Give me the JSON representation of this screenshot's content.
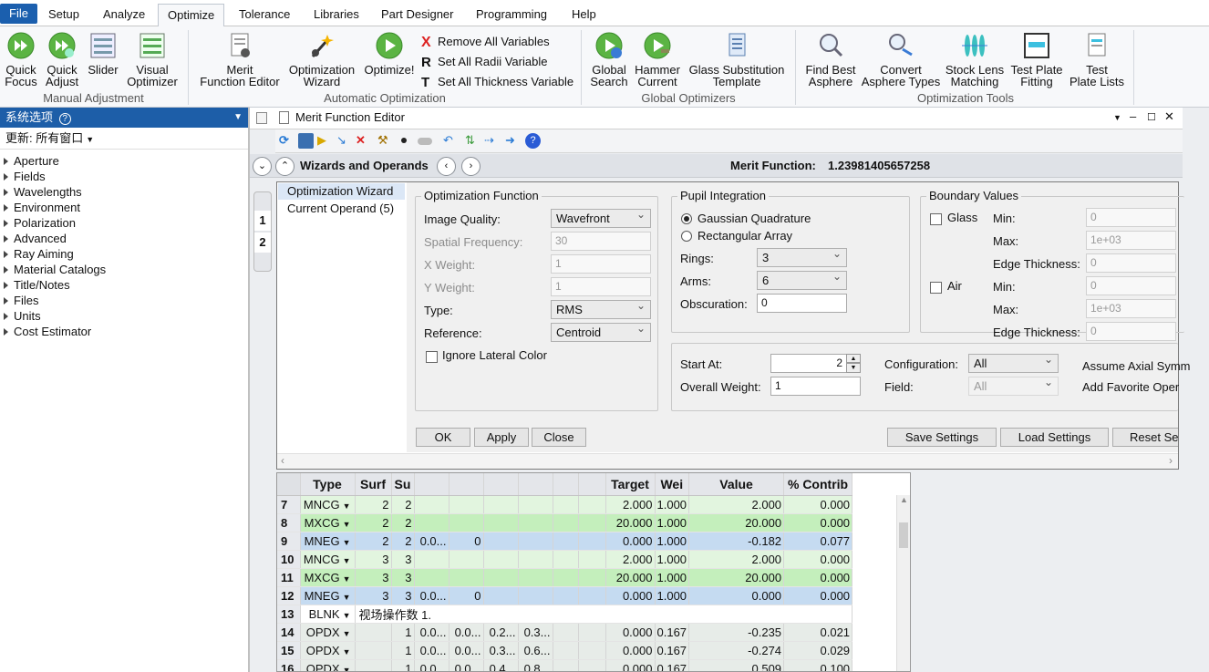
{
  "menubar": {
    "items": [
      "File",
      "Setup",
      "Analyze",
      "Optimize",
      "Tolerance",
      "Libraries",
      "Part Designer",
      "Programming",
      "Help"
    ],
    "active": "Optimize"
  },
  "ribbon": {
    "quick_focus": [
      "Quick",
      "Focus"
    ],
    "quick_adjust": [
      "Quick",
      "Adjust"
    ],
    "slider": "Slider",
    "visual_optimizer": [
      "Visual",
      "Optimizer"
    ],
    "group_manual": "Manual Adjustment",
    "merit_function_editor": [
      "Merit",
      "Function Editor"
    ],
    "optimization_wizard": [
      "Optimization",
      "Wizard"
    ],
    "optimize": "Optimize!",
    "remove_all_variables": "Remove All Variables",
    "set_all_radii_variable": "Set All Radii Variable",
    "set_all_thickness_variable": "Set All Thickness Variable",
    "group_automatic": "Automatic Optimization",
    "global_search": [
      "Global",
      "Search"
    ],
    "hammer_current": [
      "Hammer",
      "Current"
    ],
    "glass_substitution": [
      "Glass Substitution",
      "Template"
    ],
    "group_global": "Global Optimizers",
    "find_best_asphere": [
      "Find Best",
      "Asphere"
    ],
    "convert_asphere_types": [
      "Convert",
      "Asphere Types"
    ],
    "stock_lens_matching": [
      "Stock Lens",
      "Matching"
    ],
    "test_plate_fitting": [
      "Test Plate",
      "Fitting"
    ],
    "test_plate_lists": [
      "Test",
      "Plate Lists"
    ],
    "group_tools": "Optimization Tools"
  },
  "leftpanel": {
    "header": "系统选项",
    "update": "更新: 所有窗口",
    "items": [
      "Aperture",
      "Fields",
      "Wavelengths",
      "Environment",
      "Polarization",
      "Advanced",
      "Ray Aiming",
      "Material Catalogs",
      "Title/Notes",
      "Files",
      "Units",
      "Cost Estimator"
    ]
  },
  "editor": {
    "title": "Merit Function Editor",
    "wizards_label": "Wizards and Operands",
    "merit_label": "Merit Function:",
    "merit_value": "1.23981405657258",
    "tabs": [
      "1",
      "2"
    ],
    "nav": [
      "Optimization Wizard",
      "Current Operand (5)"
    ]
  },
  "wizard": {
    "opt_func_title": "Optimization Function",
    "image_quality_label": "Image Quality:",
    "image_quality": "Wavefront",
    "spatial_freq_label": "Spatial Frequency:",
    "spatial_freq": "30",
    "x_weight_label": "X Weight:",
    "x_weight": "1",
    "y_weight_label": "Y Weight:",
    "y_weight": "1",
    "type_label": "Type:",
    "type": "RMS",
    "reference_label": "Reference:",
    "reference": "Centroid",
    "ignore_lateral": "Ignore Lateral Color",
    "pupil_title": "Pupil Integration",
    "gaussian": "Gaussian Quadrature",
    "rectangular": "Rectangular Array",
    "rings_label": "Rings:",
    "rings": "3",
    "arms_label": "Arms:",
    "arms": "6",
    "obscuration_label": "Obscuration:",
    "obscuration": "0",
    "boundary_title": "Boundary Values",
    "glass": "Glass",
    "air": "Air",
    "min_label": "Min:",
    "max_label": "Max:",
    "edge_label": "Edge Thickness:",
    "glass_min": "0",
    "glass_max": "1e+03",
    "glass_edge": "0",
    "air_min": "0",
    "air_max": "1e+03",
    "air_edge": "0",
    "start_at_label": "Start At:",
    "start_at": "2",
    "overall_weight_label": "Overall Weight:",
    "overall_weight": "1",
    "configuration_label": "Configuration:",
    "configuration": "All",
    "field_label": "Field:",
    "field": "All",
    "assume_axial": "Assume Axial Symm",
    "add_favorite": "Add Favorite Oper",
    "ok": "OK",
    "apply": "Apply",
    "close": "Close",
    "save_settings": "Save Settings",
    "load_settings": "Load Settings",
    "reset_settings": "Reset Set"
  },
  "table": {
    "headers": [
      "Type",
      "Surf",
      "Su",
      "",
      "",
      "",
      "",
      "",
      "Target",
      "Wei",
      "Value",
      "% Contrib"
    ],
    "rows": [
      {
        "n": "7",
        "cls": "g1",
        "type": "MNCG",
        "c": [
          "2",
          "2",
          "",
          "",
          "",
          "",
          "",
          ""
        ],
        "target": "2.000",
        "weight": "1.000",
        "value": "2.000",
        "contrib": "0.000"
      },
      {
        "n": "8",
        "cls": "g2",
        "type": "MXCG",
        "c": [
          "2",
          "2",
          "",
          "",
          "",
          "",
          "",
          ""
        ],
        "target": "20.000",
        "weight": "1.000",
        "value": "20.000",
        "contrib": "0.000"
      },
      {
        "n": "9",
        "cls": "b",
        "type": "MNEG",
        "c": [
          "2",
          "2",
          "0.0...",
          "0",
          "",
          "",
          "",
          ""
        ],
        "target": "0.000",
        "weight": "1.000",
        "value": "-0.182",
        "contrib": "0.077"
      },
      {
        "n": "10",
        "cls": "g1",
        "type": "MNCG",
        "c": [
          "3",
          "3",
          "",
          "",
          "",
          "",
          "",
          ""
        ],
        "target": "2.000",
        "weight": "1.000",
        "value": "2.000",
        "contrib": "0.000"
      },
      {
        "n": "11",
        "cls": "g2",
        "type": "MXCG",
        "c": [
          "3",
          "3",
          "",
          "",
          "",
          "",
          "",
          ""
        ],
        "target": "20.000",
        "weight": "1.000",
        "value": "20.000",
        "contrib": "0.000"
      },
      {
        "n": "12",
        "cls": "b",
        "type": "MNEG",
        "c": [
          "3",
          "3",
          "0.0...",
          "0",
          "",
          "",
          "",
          ""
        ],
        "target": "0.000",
        "weight": "1.000",
        "value": "0.000",
        "contrib": "0.000"
      },
      {
        "n": "13",
        "cls": "w",
        "type": "BLNK",
        "comment": "视场操作数 1.",
        "c": [],
        "target": "",
        "weight": "",
        "value": "",
        "contrib": ""
      },
      {
        "n": "14",
        "cls": "gy",
        "type": "OPDX",
        "c": [
          "",
          "1",
          "0.0...",
          "0.0...",
          "0.2...",
          "0.3...",
          "",
          ""
        ],
        "target": "0.000",
        "weight": "0.167",
        "value": "-0.235",
        "contrib": "0.021"
      },
      {
        "n": "15",
        "cls": "gy",
        "type": "OPDX",
        "c": [
          "",
          "1",
          "0.0...",
          "0.0...",
          "0.3...",
          "0.6...",
          "",
          ""
        ],
        "target": "0.000",
        "weight": "0.167",
        "value": "-0.274",
        "contrib": "0.029"
      },
      {
        "n": "16",
        "cls": "gy",
        "type": "OPDX",
        "c": [
          "",
          "1",
          "0.0...",
          "0.0...",
          "0.4...",
          "0.8...",
          "",
          ""
        ],
        "target": "0.000",
        "weight": "0.167",
        "value": "0.509",
        "contrib": "0.100"
      }
    ]
  }
}
